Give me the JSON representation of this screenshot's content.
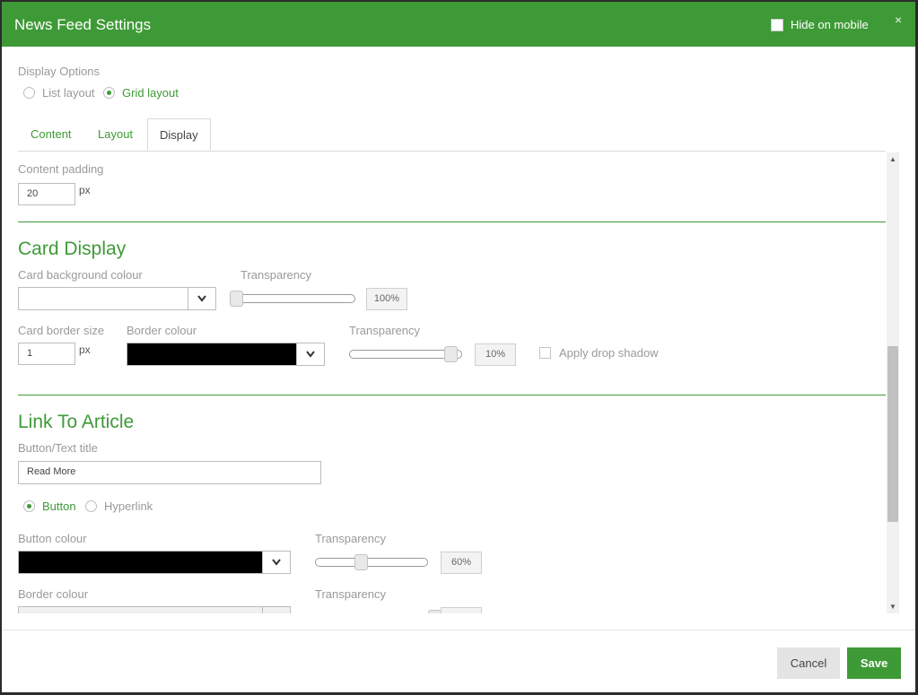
{
  "dialog": {
    "title": "News Feed Settings",
    "hide_on_mobile_label": "Hide on mobile",
    "close_glyph": "×"
  },
  "display_options": {
    "label": "Display Options",
    "list_layout": "List layout",
    "grid_layout": "Grid layout",
    "selected": "Grid layout"
  },
  "tabs": [
    {
      "label": "Content"
    },
    {
      "label": "Layout"
    },
    {
      "label": "Display",
      "active": true
    }
  ],
  "content_padding": {
    "label": "Content padding",
    "value": "20",
    "unit": "px"
  },
  "card_display": {
    "title": "Card Display",
    "background_label": "Card background colour",
    "background_value": "",
    "bg_transparency_label": "Transparency",
    "bg_transparency_value": "100%",
    "bg_transparency_level": 0,
    "border_size_label": "Card border size",
    "border_size_value": "1",
    "border_size_unit": "px",
    "border_colour_label": "Border colour",
    "border_colour_value": "#000000",
    "border_transparency_label": "Transparency",
    "border_transparency_value": "10%",
    "border_transparency_level": 0.9,
    "drop_shadow_label": "Apply drop shadow"
  },
  "link_to_article": {
    "title": "Link To Article",
    "button_text_label": "Button/Text title",
    "button_text_value": "Read More",
    "button_option": "Button",
    "hyperlink_option": "Hyperlink",
    "selected": "Button",
    "button_colour_label": "Button colour",
    "button_colour_value": "#000000",
    "button_transparency_label": "Transparency",
    "button_transparency_value": "60%",
    "button_transparency_level": 0.4,
    "border_colour_label": "Border colour",
    "border_transparency_label": "Transparency",
    "border_transparency_level": 1
  },
  "footer": {
    "cancel_label": "Cancel",
    "save_label": "Save"
  },
  "colors": {
    "accent": "#3e9a36"
  }
}
